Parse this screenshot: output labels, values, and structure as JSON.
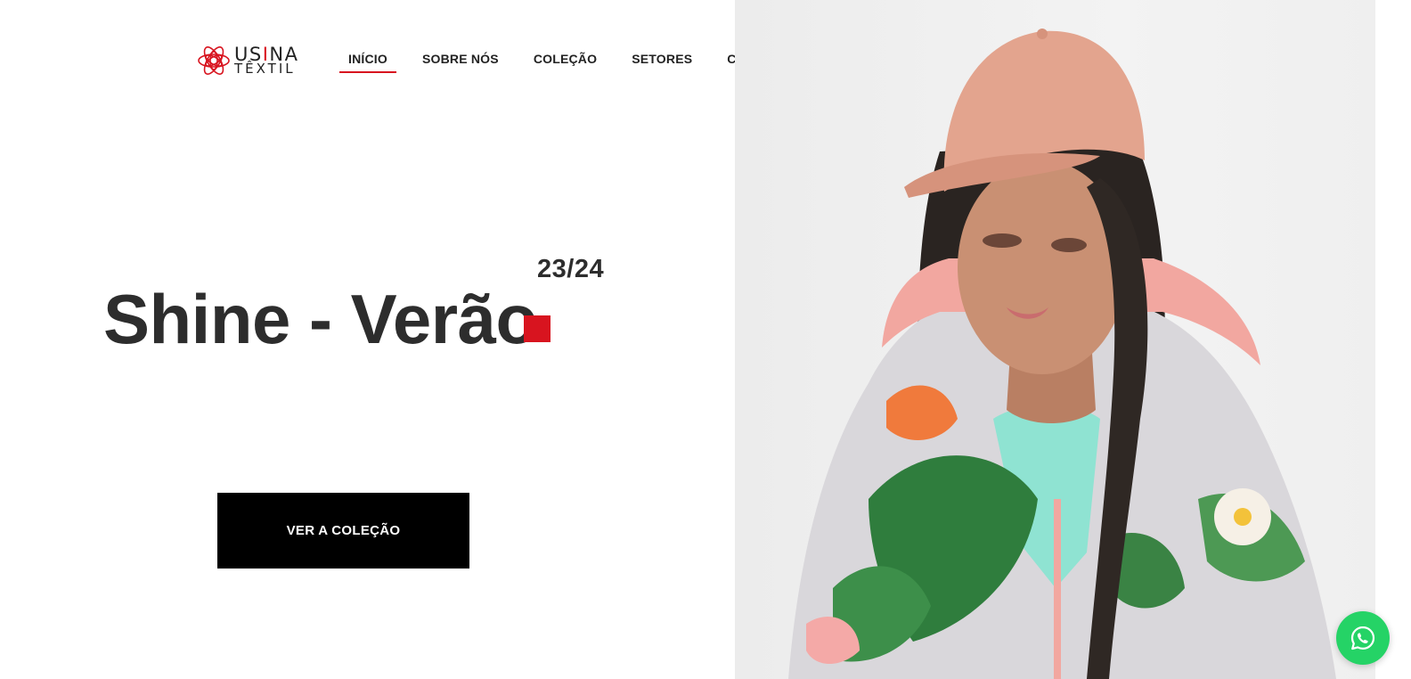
{
  "header": {
    "logo": {
      "word1_a": "US",
      "word1_accent": "I",
      "word1_b": "NA",
      "word2": "TÊXTIL"
    },
    "nav": [
      {
        "label": "INÍCIO",
        "active": true
      },
      {
        "label": "SOBRE NÓS",
        "active": false
      },
      {
        "label": "COLEÇÃO",
        "active": false
      },
      {
        "label": "SETORES",
        "active": false
      },
      {
        "label": "CONTATO",
        "active": false
      }
    ]
  },
  "hero": {
    "title": "Shine - Verão",
    "season": "23/24",
    "cta_label": "VER A COLEÇÃO",
    "image_icon": "model-photo"
  },
  "floating": {
    "whatsapp_icon": "whatsapp-icon"
  },
  "colors": {
    "accent": "#d8141f",
    "text": "#2d2d2d",
    "cta_background": "#000000",
    "whatsapp": "#25d366"
  }
}
